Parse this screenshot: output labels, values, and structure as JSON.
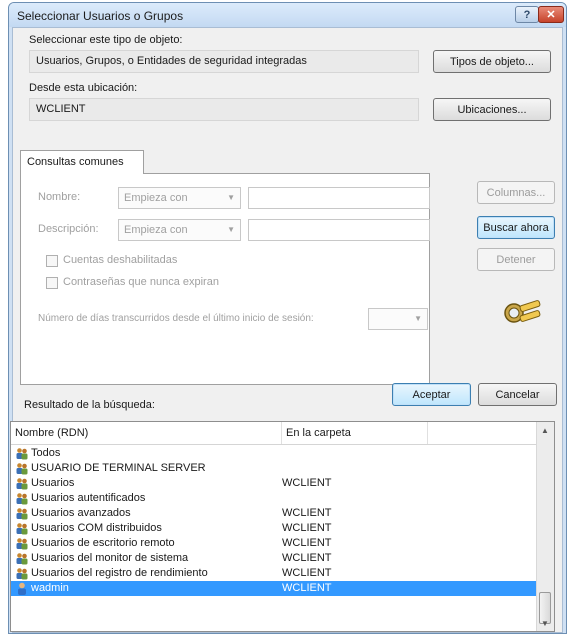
{
  "window": {
    "title": "Seleccionar Usuarios o Grupos",
    "help_label": "?",
    "close_label": "✕"
  },
  "object_type": {
    "label": "Seleccionar este tipo de objeto:",
    "value": "Usuarios, Grupos, o Entidades de seguridad integradas",
    "button": "Tipos de objeto..."
  },
  "location": {
    "label": "Desde esta ubicación:",
    "value": "WCLIENT",
    "button": "Ubicaciones..."
  },
  "common_queries": {
    "tab": "Consultas comunes",
    "name_label": "Nombre:",
    "name_combo": "Empieza con",
    "desc_label": "Descripción:",
    "desc_combo": "Empieza con",
    "disabled_accounts": "Cuentas deshabilitadas",
    "non_expiring": "Contraseñas que nunca expiran",
    "days_label": "Número de días transcurridos desde el último inicio de sesión:"
  },
  "side_buttons": {
    "columns": "Columnas...",
    "search_now": "Buscar ahora",
    "stop": "Detener"
  },
  "footer": {
    "results_label": "Resultado de la búsqueda:",
    "ok": "Aceptar",
    "cancel": "Cancelar"
  },
  "results": {
    "columns": [
      "Nombre (RDN)",
      "En la carpeta"
    ],
    "rows": [
      {
        "name": "Todos",
        "folder": "",
        "icon": "group-icon",
        "selected": false
      },
      {
        "name": "USUARIO DE TERMINAL SERVER",
        "folder": "",
        "icon": "group-icon",
        "selected": false
      },
      {
        "name": "Usuarios",
        "folder": "WCLIENT",
        "icon": "group-icon",
        "selected": false
      },
      {
        "name": "Usuarios autentificados",
        "folder": "",
        "icon": "group-icon",
        "selected": false
      },
      {
        "name": "Usuarios avanzados",
        "folder": "WCLIENT",
        "icon": "group-icon",
        "selected": false
      },
      {
        "name": "Usuarios COM distribuidos",
        "folder": "WCLIENT",
        "icon": "group-icon",
        "selected": false
      },
      {
        "name": "Usuarios de escritorio remoto",
        "folder": "WCLIENT",
        "icon": "group-icon",
        "selected": false
      },
      {
        "name": "Usuarios del monitor de sistema",
        "folder": "WCLIENT",
        "icon": "group-icon",
        "selected": false
      },
      {
        "name": "Usuarios del registro de rendimiento",
        "folder": "WCLIENT",
        "icon": "group-icon",
        "selected": false
      },
      {
        "name": "wadmin",
        "folder": "WCLIENT",
        "icon": "user-icon",
        "selected": true
      }
    ]
  },
  "colors": {
    "selection": "#3399ff",
    "frame": "#cfe0f3",
    "close_button": "#c6432b"
  }
}
